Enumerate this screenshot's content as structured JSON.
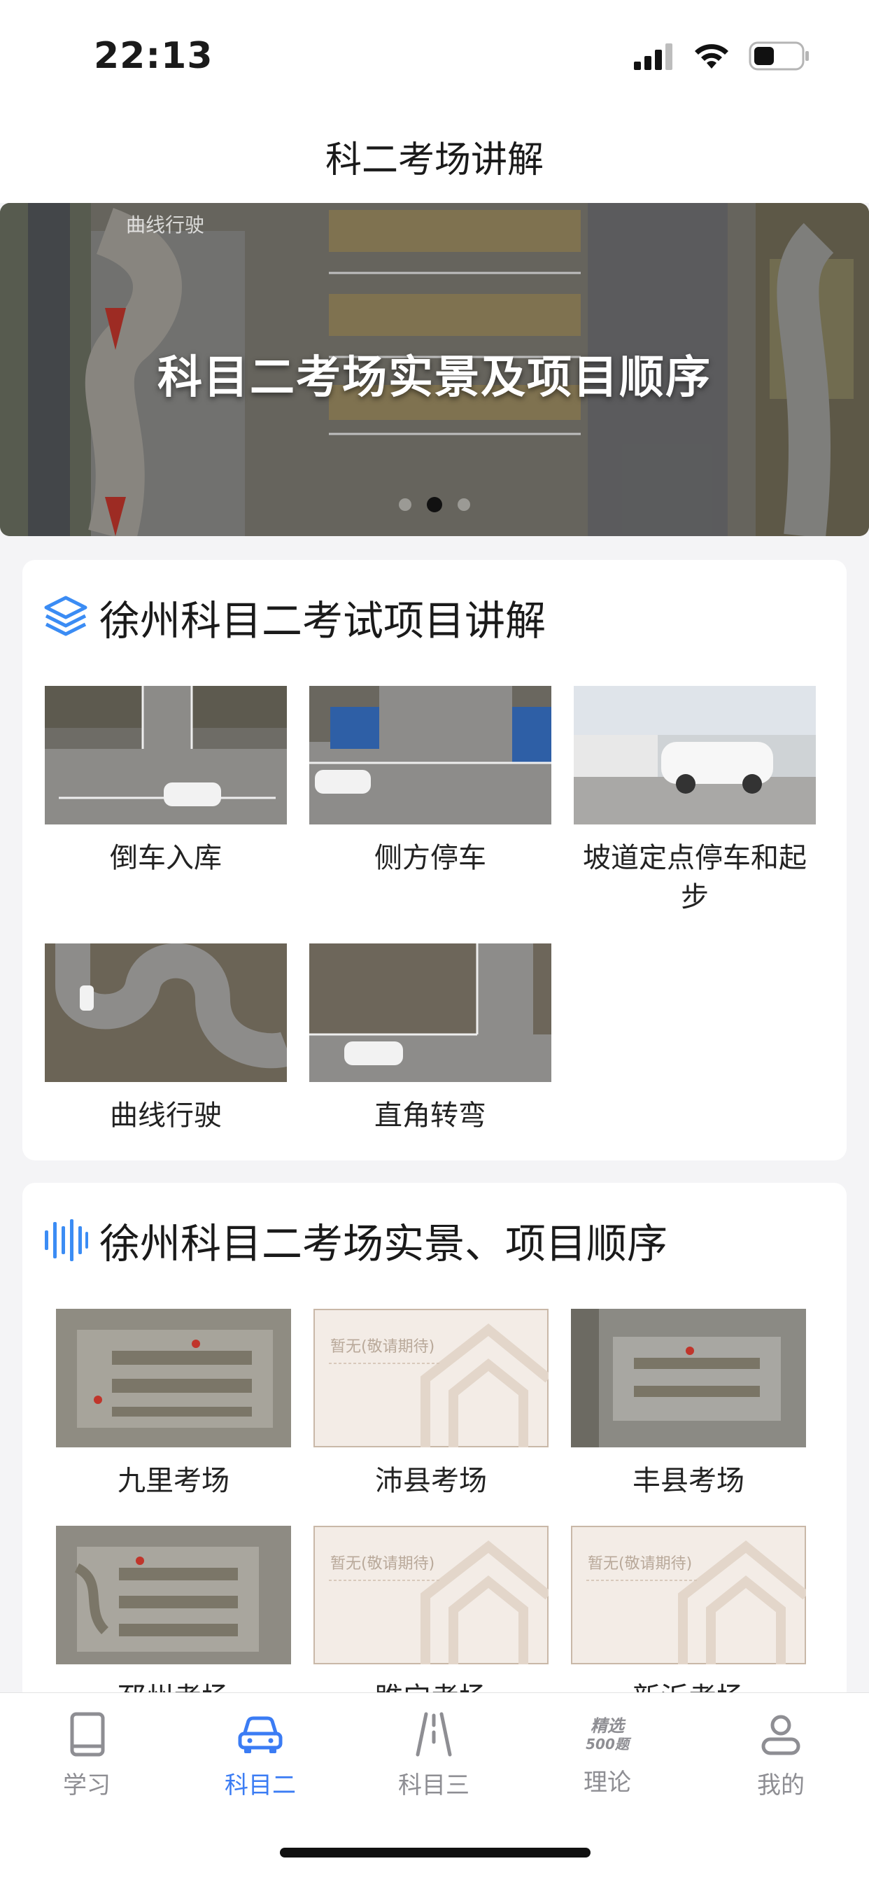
{
  "status_bar": {
    "time": "22:13"
  },
  "nav": {
    "title": "科二考场讲解"
  },
  "banner": {
    "title": "科目二考场实景及项目顺序",
    "watermark": "曲线行驶",
    "dot_count": 3,
    "active_dot": 1
  },
  "section_items": {
    "title": "徐州科目二考试项目讲解",
    "items": [
      {
        "label": "倒车入库"
      },
      {
        "label": "侧方停车"
      },
      {
        "label": "坡道定点停车和起步"
      },
      {
        "label": "曲线行驶"
      },
      {
        "label": "直角转弯"
      }
    ]
  },
  "section_venues": {
    "title": "徐州科目二考场实景、项目顺序",
    "placeholder_text": "暂无(敬请期待)",
    "venues": [
      {
        "label": "九里考场"
      },
      {
        "label": "沛县考场"
      },
      {
        "label": "丰县考场"
      },
      {
        "label": "邳州考场"
      },
      {
        "label": "睢宁考场"
      },
      {
        "label": "新沂考场"
      }
    ]
  },
  "tab_bar": {
    "tabs": [
      {
        "label": "学习",
        "icon": "book-icon"
      },
      {
        "label": "科目二",
        "icon": "car-icon"
      },
      {
        "label": "科目三",
        "icon": "road-icon"
      },
      {
        "label": "理论",
        "icon": "question-bank-icon",
        "badge_line1": "精选",
        "badge_line2": "500题"
      },
      {
        "label": "我的",
        "icon": "profile-icon"
      }
    ],
    "active_index": 1
  },
  "colors": {
    "accent": "#3b7cf4",
    "tab_inactive": "#8e8e93",
    "placeholder_bg": "#f3ece6"
  }
}
